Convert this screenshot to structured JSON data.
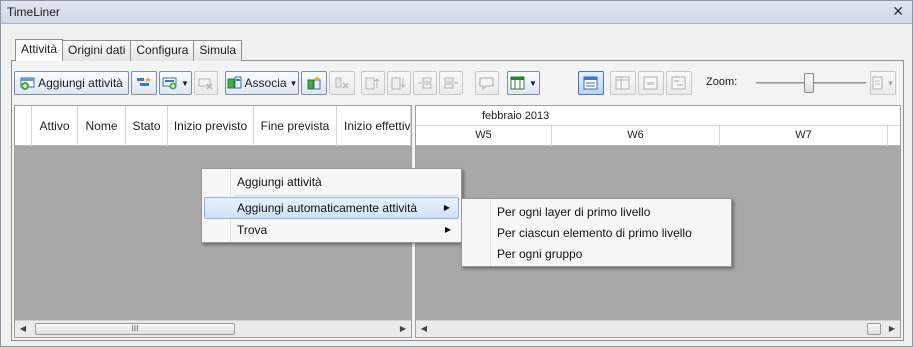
{
  "window": {
    "title": "TimeLiner",
    "close_glyph": "✕"
  },
  "tabs": [
    {
      "label": "Attività",
      "active": true
    },
    {
      "label": "Origini dati",
      "active": false
    },
    {
      "label": "Configura",
      "active": false
    },
    {
      "label": "Simula",
      "active": false
    }
  ],
  "toolbar": {
    "add_task_label": "Aggiungi attività",
    "attach_label": "Associa",
    "zoom_label": "Zoom:",
    "zoom_level": 0.5
  },
  "grid": {
    "columns": [
      "Attivo",
      "Nome",
      "Stato",
      "Inizio previsto",
      "Fine prevista",
      "Inizio effettivo"
    ]
  },
  "gantt": {
    "month": "febbraio 2013",
    "weeks": [
      "W5",
      "W6",
      "W7"
    ]
  },
  "scroll": {
    "thumb_glyph": "III"
  },
  "context_menu": {
    "items": [
      {
        "label": "Aggiungi attività"
      },
      {
        "label": "Aggiungi automaticamente attività",
        "submenu": true
      },
      {
        "label": "Trova",
        "submenu": true
      }
    ],
    "submenu_arrow": "▶"
  },
  "submenu": {
    "items": [
      {
        "label": "Per ogni layer di primo livello"
      },
      {
        "label": "Per ciascun elemento di primo livello"
      },
      {
        "label": "Per ogni gruppo"
      }
    ]
  },
  "colors": {
    "grid_bg": "#a8a8a8",
    "highlight": "#cfe2f8",
    "selected_tool": "#b9d4f5"
  }
}
